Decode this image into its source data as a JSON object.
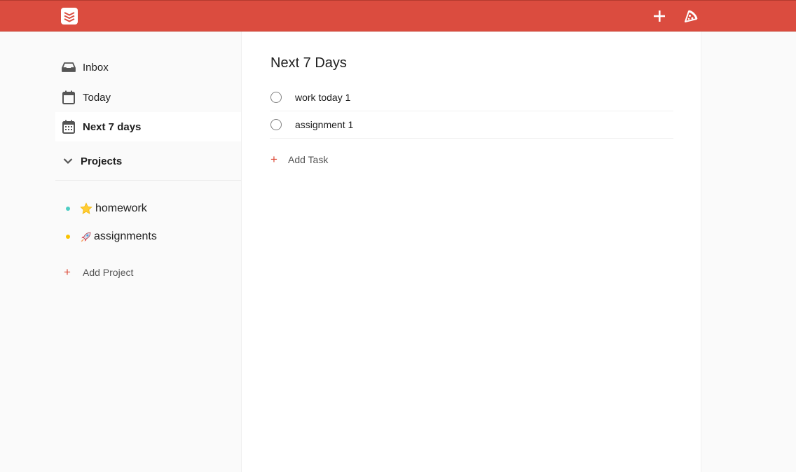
{
  "topbar": {
    "logo_icon": "todoist-logo-icon",
    "add_icon": "plus-icon",
    "karma_icon": "pizza-icon",
    "color": "#db4c3f"
  },
  "sidebar": {
    "items": [
      {
        "label": "Inbox",
        "icon": "inbox-icon"
      },
      {
        "label": "Today",
        "icon": "calendar-icon"
      },
      {
        "label": "Next 7 days",
        "icon": "calendar-week-icon",
        "active": true
      }
    ],
    "projects_label": "Projects",
    "projects": [
      {
        "emoji": "⭐",
        "name": "homework",
        "color": "#4ecdc4"
      },
      {
        "emoji": "🚀",
        "name": "assignments",
        "color": "#f9c300"
      }
    ],
    "add_project_label": "Add Project"
  },
  "main": {
    "title": "Next 7 Days",
    "tasks": [
      {
        "text": "work today 1"
      },
      {
        "text": "assignment 1"
      }
    ],
    "add_task_label": "Add Task"
  },
  "accent": "#dd4b39"
}
